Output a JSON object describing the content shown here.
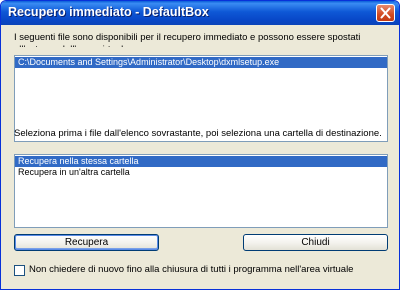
{
  "window": {
    "title": "Recupero immediato - DefaultBox"
  },
  "description": "I seguenti file sono disponibili per il recupero immediato e possono essere spostati all'esterno dell'area virtuale",
  "files_list": {
    "items": [
      {
        "label": "C:\\Documents and Settings\\Administrator\\Desktop\\dxmlsetup.exe",
        "selected": true
      }
    ]
  },
  "instruction": "Seleziona prima i file dall'elenco sovrastante, poi seleziona una cartella di destinazione.",
  "folder_options": {
    "items": [
      {
        "label": "Recupera nella stessa cartella",
        "selected": true
      },
      {
        "label": "Recupera in un'altra cartella",
        "selected": false
      }
    ]
  },
  "buttons": {
    "recover": "Recupera",
    "close": "Chiudi"
  },
  "checkbox": {
    "label": "Non chiedere di nuovo fino alla chiusura di tutti i programma nell'area virtuale",
    "checked": false
  },
  "icons": {
    "close": "close-icon"
  },
  "colors": {
    "titlebar": "#0a5ed8",
    "selection": "#316ac5",
    "dialog_bg": "#ece9d8",
    "close_button": "#d24a21"
  }
}
